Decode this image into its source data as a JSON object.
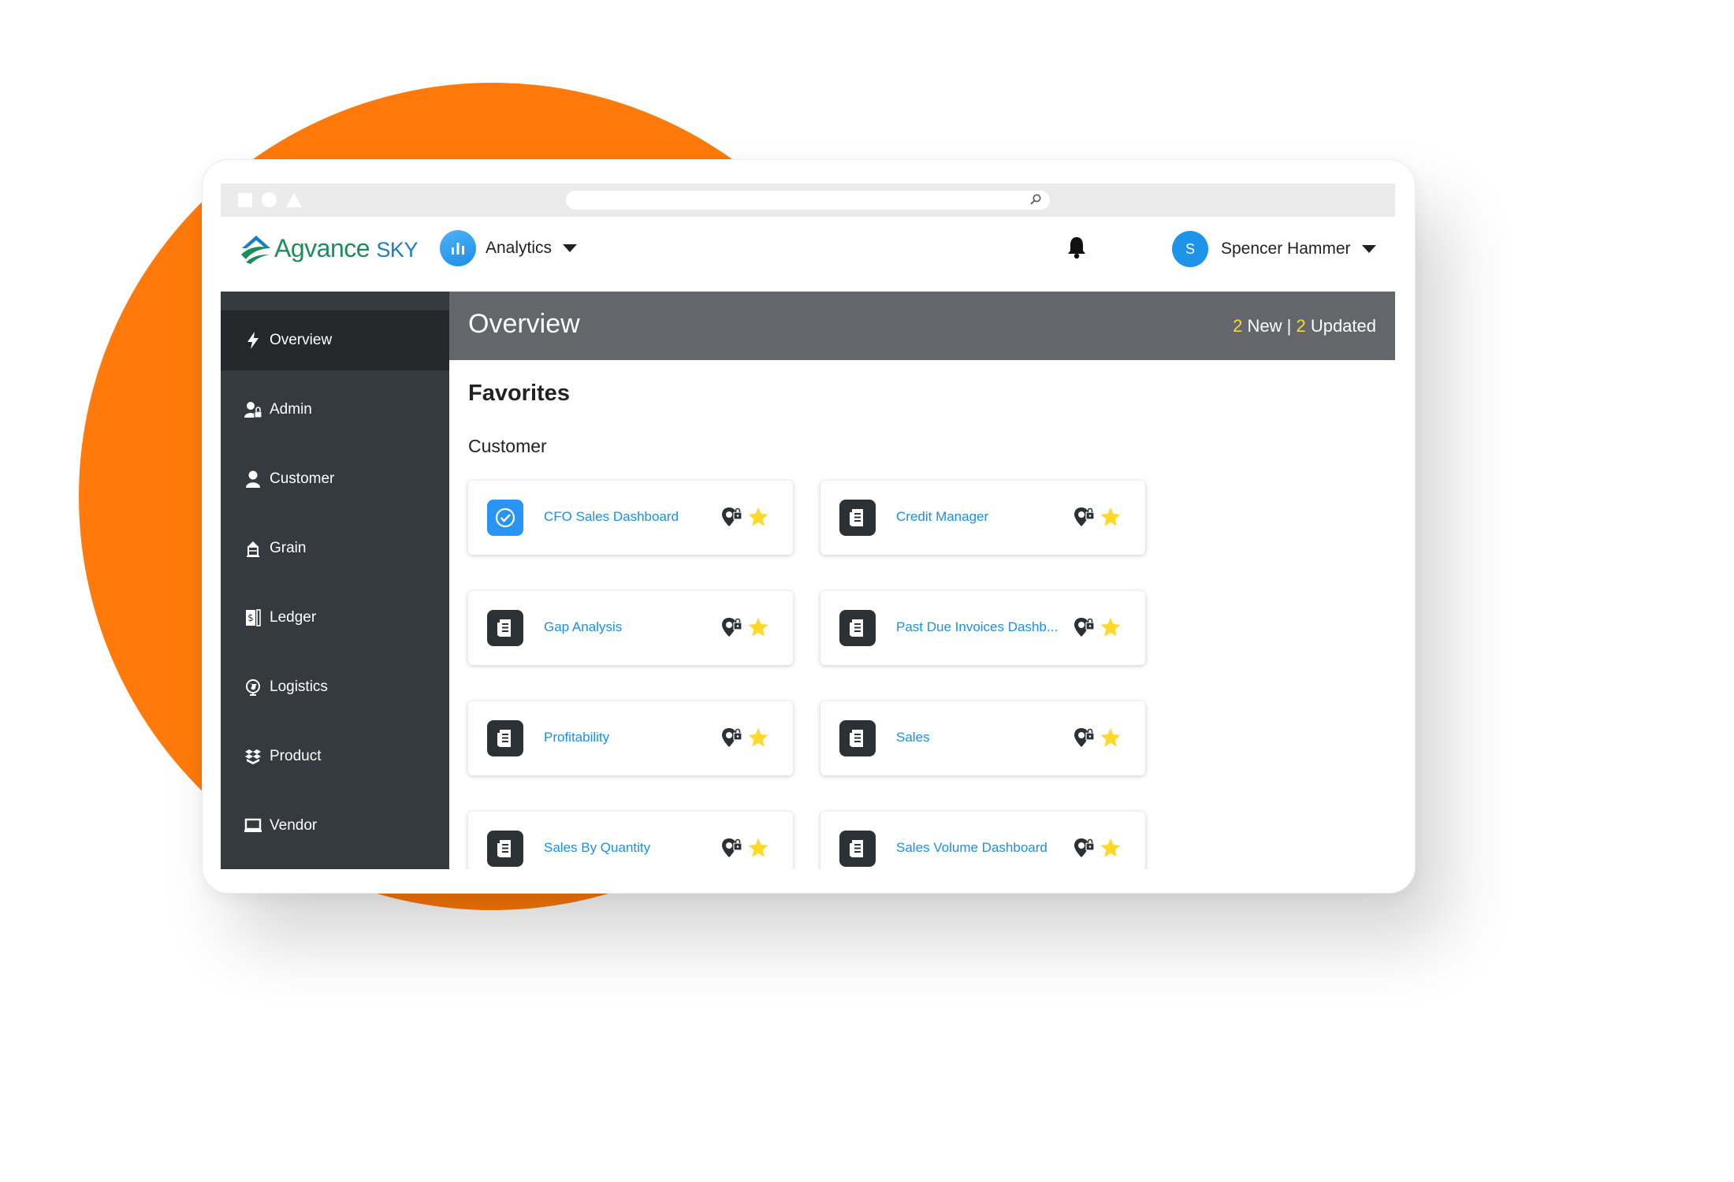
{
  "brand": {
    "logo_main": "Agvance",
    "logo_sky": "SKY",
    "colors": {
      "orange": "#ff7a0a",
      "green": "#1f8c5c",
      "blue": "#1d8fe3",
      "star": "#ffd92a",
      "sidebar": "#343a3f"
    }
  },
  "header": {
    "app_label": "Analytics",
    "user_initial": "S",
    "user_name": "Spencer Hammer"
  },
  "sidebar": {
    "items": [
      {
        "label": "Overview",
        "icon": "bolt-icon",
        "active": true
      },
      {
        "label": "Admin",
        "icon": "admin-user-lock-icon"
      },
      {
        "label": "Customer",
        "icon": "user-icon"
      },
      {
        "label": "Grain",
        "icon": "grain-elevator-icon"
      },
      {
        "label": "Ledger",
        "icon": "ledger-icon"
      },
      {
        "label": "Logistics",
        "icon": "globe-icon"
      },
      {
        "label": "Product",
        "icon": "boxes-icon"
      },
      {
        "label": "Vendor",
        "icon": "vendor-icon"
      }
    ]
  },
  "main": {
    "title": "Overview",
    "status": {
      "new_count": "2",
      "new_label": " New",
      "separator": " | ",
      "updated_count": "2",
      "updated_label": " Updated"
    },
    "favorites_heading": "Favorites",
    "section_heading": "Customer",
    "cards": [
      {
        "title": "CFO Sales Dashboard",
        "icon": "check-circle-icon",
        "icon_style": "blue"
      },
      {
        "title": "Credit Manager",
        "icon": "report-icon",
        "icon_style": "dark"
      },
      {
        "title": "Gap Analysis",
        "icon": "report-icon",
        "icon_style": "dark"
      },
      {
        "title": "Past Due Invoices Dashb...",
        "icon": "report-icon",
        "icon_style": "dark"
      },
      {
        "title": "Profitability",
        "icon": "report-icon",
        "icon_style": "dark"
      },
      {
        "title": "Sales",
        "icon": "report-icon",
        "icon_style": "dark"
      },
      {
        "title": "Sales By Quantity",
        "icon": "report-icon",
        "icon_style": "dark"
      },
      {
        "title": "Sales Volume Dashboard",
        "icon": "report-icon",
        "icon_style": "dark"
      }
    ]
  }
}
